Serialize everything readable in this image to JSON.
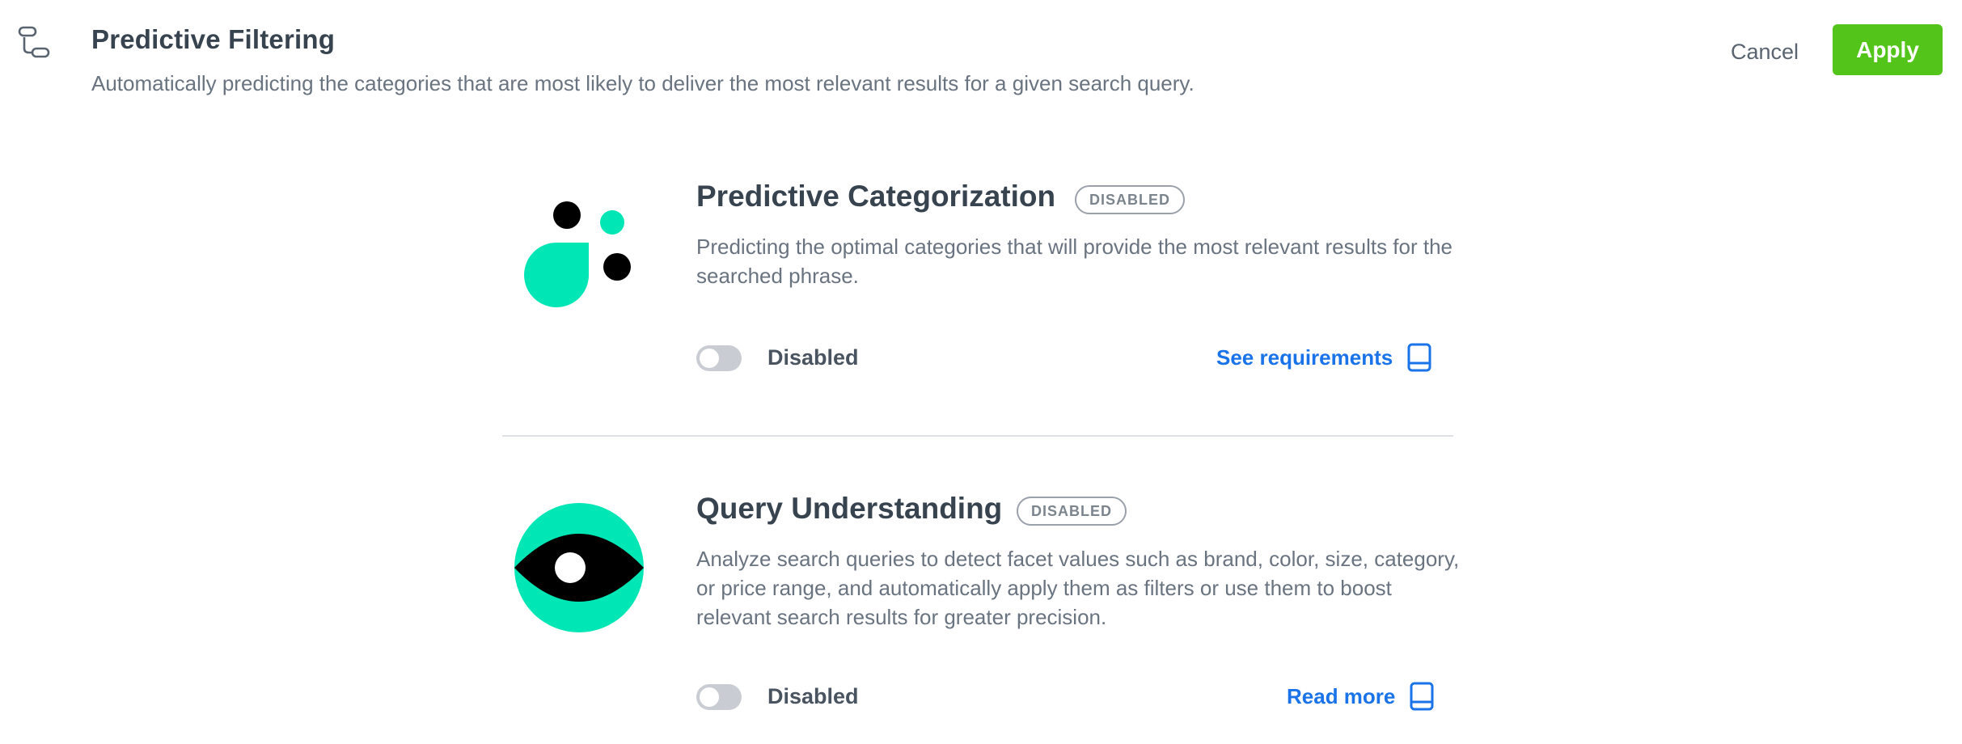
{
  "header": {
    "icon": "flow-steps-icon",
    "title": "Predictive Filtering",
    "subtitle": "Automatically predicting the categories that are most likely to deliver the most relevant results for a given search query.",
    "cancel_label": "Cancel",
    "apply_label": "Apply"
  },
  "colors": {
    "accent_green": "#52c41a",
    "teal": "#00e6b4",
    "link_blue": "#1a73e8"
  },
  "features": [
    {
      "title": "Predictive Categorization",
      "badge": "DISABLED",
      "description": "Predicting the optimal categories that will provide the most relevant results for the searched phrase.",
      "toggle_enabled": false,
      "toggle_label": "Disabled",
      "link_label": "See requirements",
      "link_icon": "book-icon"
    },
    {
      "title": "Query Understanding",
      "badge": "DISABLED",
      "description": "Analyze search queries to detect facet values such as brand, color, size, category, or price range, and automatically apply them as filters or use them to boost relevant search results for greater precision.",
      "toggle_enabled": false,
      "toggle_label": "Disabled",
      "link_label": "Read more",
      "link_icon": "book-icon"
    }
  ]
}
